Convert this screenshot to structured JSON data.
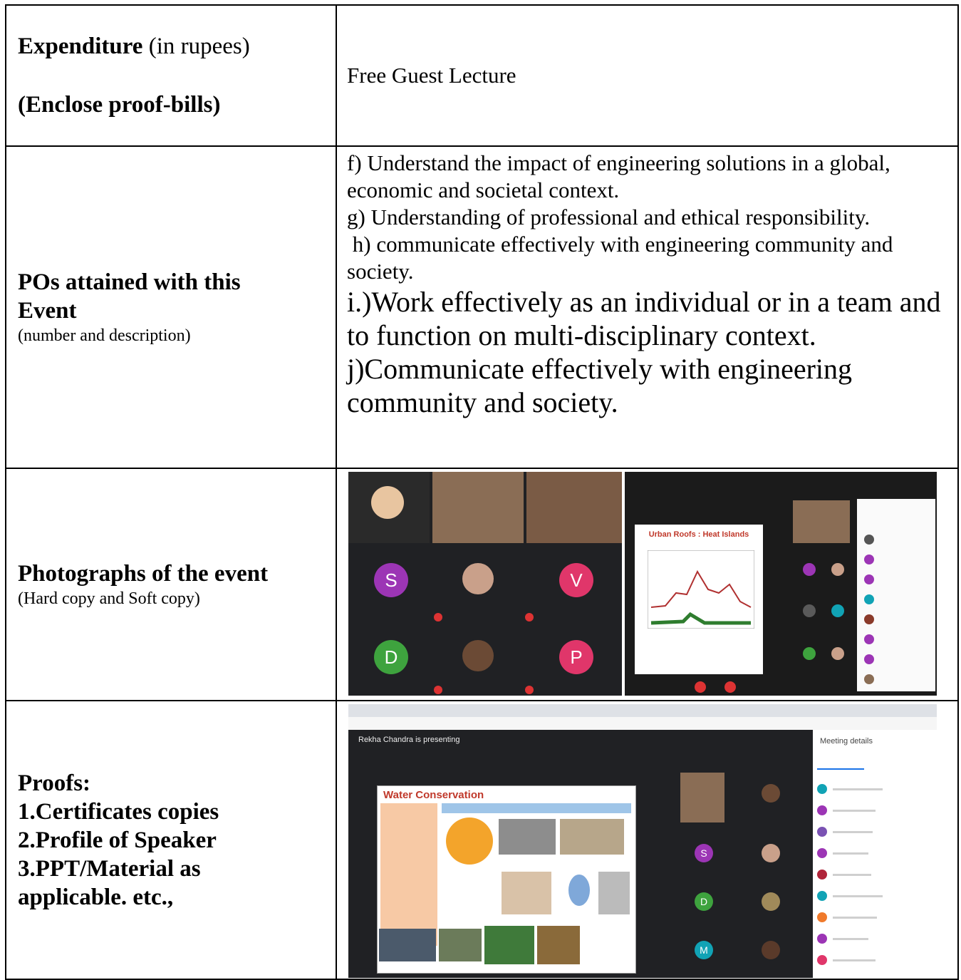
{
  "rows": {
    "expenditure": {
      "label_bold": "Expenditure",
      "label_paren_open": " (",
      "label_normal": "in rupees",
      "label_paren_close": ")",
      "label_line2": "(Enclose proof-bills)",
      "value": "Free Guest Lecture"
    },
    "pos": {
      "label_line1": "POs attained with this",
      "label_line2": "Event",
      "label_sub": "(number and description)",
      "items_small": [
        "f) Understand the impact of engineering solutions in a global, economic and societal context.",
        "g) Understanding of professional and ethical responsibility.",
        " h) communicate effectively with engineering community and society."
      ],
      "items_large": [
        "i.)Work effectively as an individual or in a team and to function on multi-disciplinary context.",
        "j)Communicate effectively with engineering community and society."
      ]
    },
    "photos": {
      "label": "Photographs of the event",
      "label_sub": "(Hard copy and Soft copy)",
      "avatars": [
        "S",
        "V",
        "D",
        "P"
      ],
      "slide_title": "Urban Roofs : Heat Islands"
    },
    "proofs": {
      "label_title": "Proofs:",
      "items": [
        "1.Certificates copies",
        "2.Profile of Speaker",
        "3.PPT/Material as",
        "applicable. etc.,"
      ],
      "presenting_text": "Rekha Chandra is presenting",
      "slide_title": "Water Conservation",
      "sidebar_title": "Meeting details",
      "avatars": [
        "S",
        "D",
        "M"
      ]
    }
  },
  "colors": {
    "border": "#000000",
    "avatar_purple": "#9c35b5",
    "avatar_pink": "#e0366a",
    "avatar_green": "#3ea33e",
    "avatar_teal": "#11a3b5",
    "slide_red": "#c0392b"
  }
}
